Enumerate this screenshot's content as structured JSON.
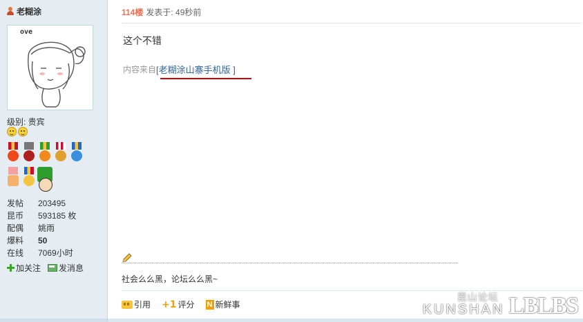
{
  "author": {
    "name": "老糊涂",
    "avatar_tag": "ove"
  },
  "profile": {
    "level_label": "级别: 贵宾",
    "stats": [
      {
        "label": "发帖",
        "value": "203495",
        "bold": false
      },
      {
        "label": "昆币",
        "value": "593185 枚",
        "bold": false
      },
      {
        "label": "配偶",
        "value": "姚雨",
        "bold": false
      },
      {
        "label": "爆料",
        "value": "50",
        "bold": true
      },
      {
        "label": "在线",
        "value": "7069小时",
        "bold": false
      }
    ],
    "actions": {
      "follow": "加关注",
      "message": "发消息"
    }
  },
  "post": {
    "floor": "114楼",
    "posted_time": "发表于: 49秒前",
    "content": "这个不错",
    "source_prefix": "内容来自",
    "source_link": "[老糊涂山寨手机版 ]",
    "signature": "社会么么黑，论坛么么黑~"
  },
  "toolbar": {
    "quote": "引用",
    "rate": "评分",
    "news": "新鲜事"
  },
  "watermark": {
    "cn": "昆山论坛",
    "en": "KUNSHAN",
    "logo": "LBLBS"
  },
  "colors": {
    "floor": "#f26c4f",
    "link": "#336699",
    "underline": "#d40000",
    "sidebar": "#e5edf2"
  }
}
